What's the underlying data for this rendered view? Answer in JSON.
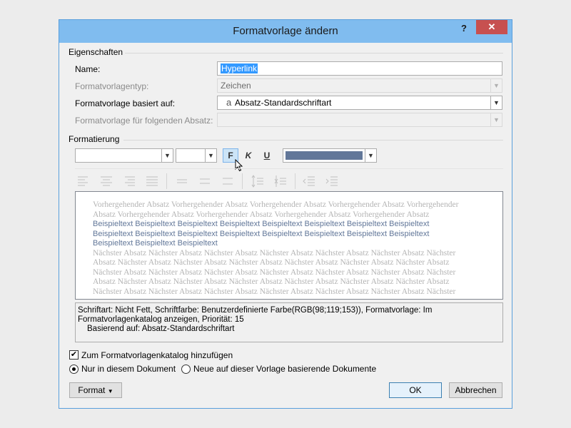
{
  "window": {
    "title": "Formatvorlage ändern",
    "help": "?",
    "close": "✕"
  },
  "properties": {
    "section": "Eigenschaften",
    "name_label": "Name:",
    "name_value": "Hyperlink",
    "type_label": "Formatvorlagentyp:",
    "type_value": "Zeichen",
    "based_on_label": "Formatvorlage basiert auf:",
    "based_on_glyph": "a",
    "based_on_value": "Absatz-Standardschriftart",
    "following_label": "Formatvorlage für folgenden Absatz:",
    "following_value": ""
  },
  "formatting": {
    "section": "Formatierung",
    "font_value": "",
    "size_value": "",
    "bold": "F",
    "italic": "K",
    "underline": "U",
    "color_value": "#627799"
  },
  "preview": {
    "prev_lines": [
      "Vorhergehender Absatz Vorhergehender Absatz Vorhergehender Absatz Vorhergehender Absatz Vorhergehender",
      "Absatz Vorhergehender Absatz Vorhergehender Absatz Vorhergehender Absatz Vorhergehender Absatz"
    ],
    "sample_lines": [
      "Beispieltext Beispieltext Beispieltext Beispieltext Beispieltext Beispieltext Beispieltext Beispieltext",
      "Beispieltext Beispieltext Beispieltext Beispieltext Beispieltext Beispieltext Beispieltext Beispieltext",
      "Beispieltext Beispieltext Beispieltext"
    ],
    "next_lines": [
      "Nächster Absatz Nächster Absatz Nächster Absatz Nächster Absatz Nächster Absatz Nächster Absatz Nächster",
      "Absatz Nächster Absatz Nächster Absatz Nächster Absatz Nächster Absatz Nächster Absatz Nächster Absatz",
      "Nächster Absatz Nächster Absatz Nächster Absatz Nächster Absatz Nächster Absatz Nächster Absatz Nächster",
      "Absatz Nächster Absatz Nächster Absatz Nächster Absatz Nächster Absatz Nächster Absatz Nächster Absatz",
      "Nächster Absatz Nächster Absatz Nächster Absatz Nächster Absatz Nächster Absatz Nächster Absatz Nächster"
    ]
  },
  "description": {
    "line1": "Schriftart: Nicht Fett, Schriftfarbe: Benutzerdefinierte Farbe(RGB(98;119;153)), Formatvorlage: Im",
    "line2": "Formatvorlagenkatalog anzeigen, Priorität: 15",
    "line3": "Basierend auf: Absatz-Standardschriftart"
  },
  "options": {
    "add_to_gallery": "Zum Formatvorlagenkatalog hinzufügen",
    "add_to_gallery_checked": true,
    "only_this_doc": "Nur in diesem Dokument",
    "new_docs": "Neue auf dieser Vorlage basierende Dokumente"
  },
  "buttons": {
    "format": "Format",
    "ok": "OK",
    "cancel": "Abbrechen"
  }
}
